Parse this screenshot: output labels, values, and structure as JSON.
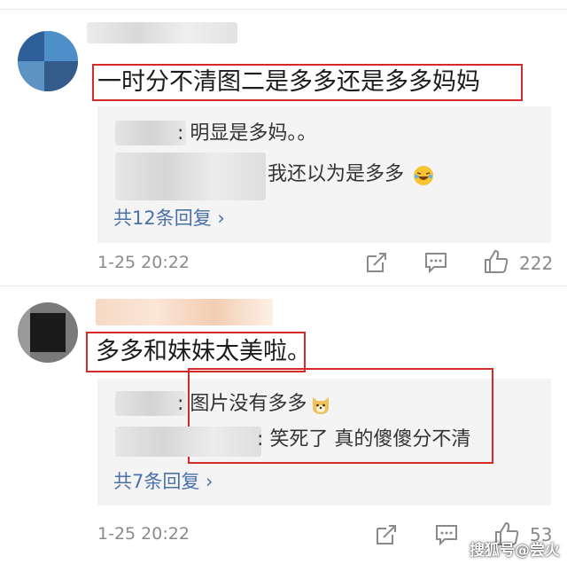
{
  "comments": [
    {
      "text": "一时分不清图二是多多还是多多妈妈",
      "replies": [
        {
          "text": ": 明显是多妈。。"
        },
        {
          "text": "我还以为是多多"
        }
      ],
      "more_replies": "共12条回复 ›",
      "time": "1-25 20:22",
      "likes": "222"
    },
    {
      "text": "多多和妹妹太美啦。",
      "replies": [
        {
          "text": ": 图片没有多多"
        },
        {
          "text": ": 笑死了 真的傻傻分不清"
        }
      ],
      "more_replies": "共7条回复 ›",
      "time": "1-25 20:22",
      "likes": "53"
    }
  ],
  "watermark": "搜狐号@尝火",
  "colors": {
    "highlight_box": "#d62a2a",
    "link": "#4a70a8",
    "muted": "#8a8a8a"
  },
  "icons": [
    "share-icon",
    "comment-icon",
    "like-icon",
    "laughing-emoji-icon",
    "dog-emoji-icon"
  ]
}
